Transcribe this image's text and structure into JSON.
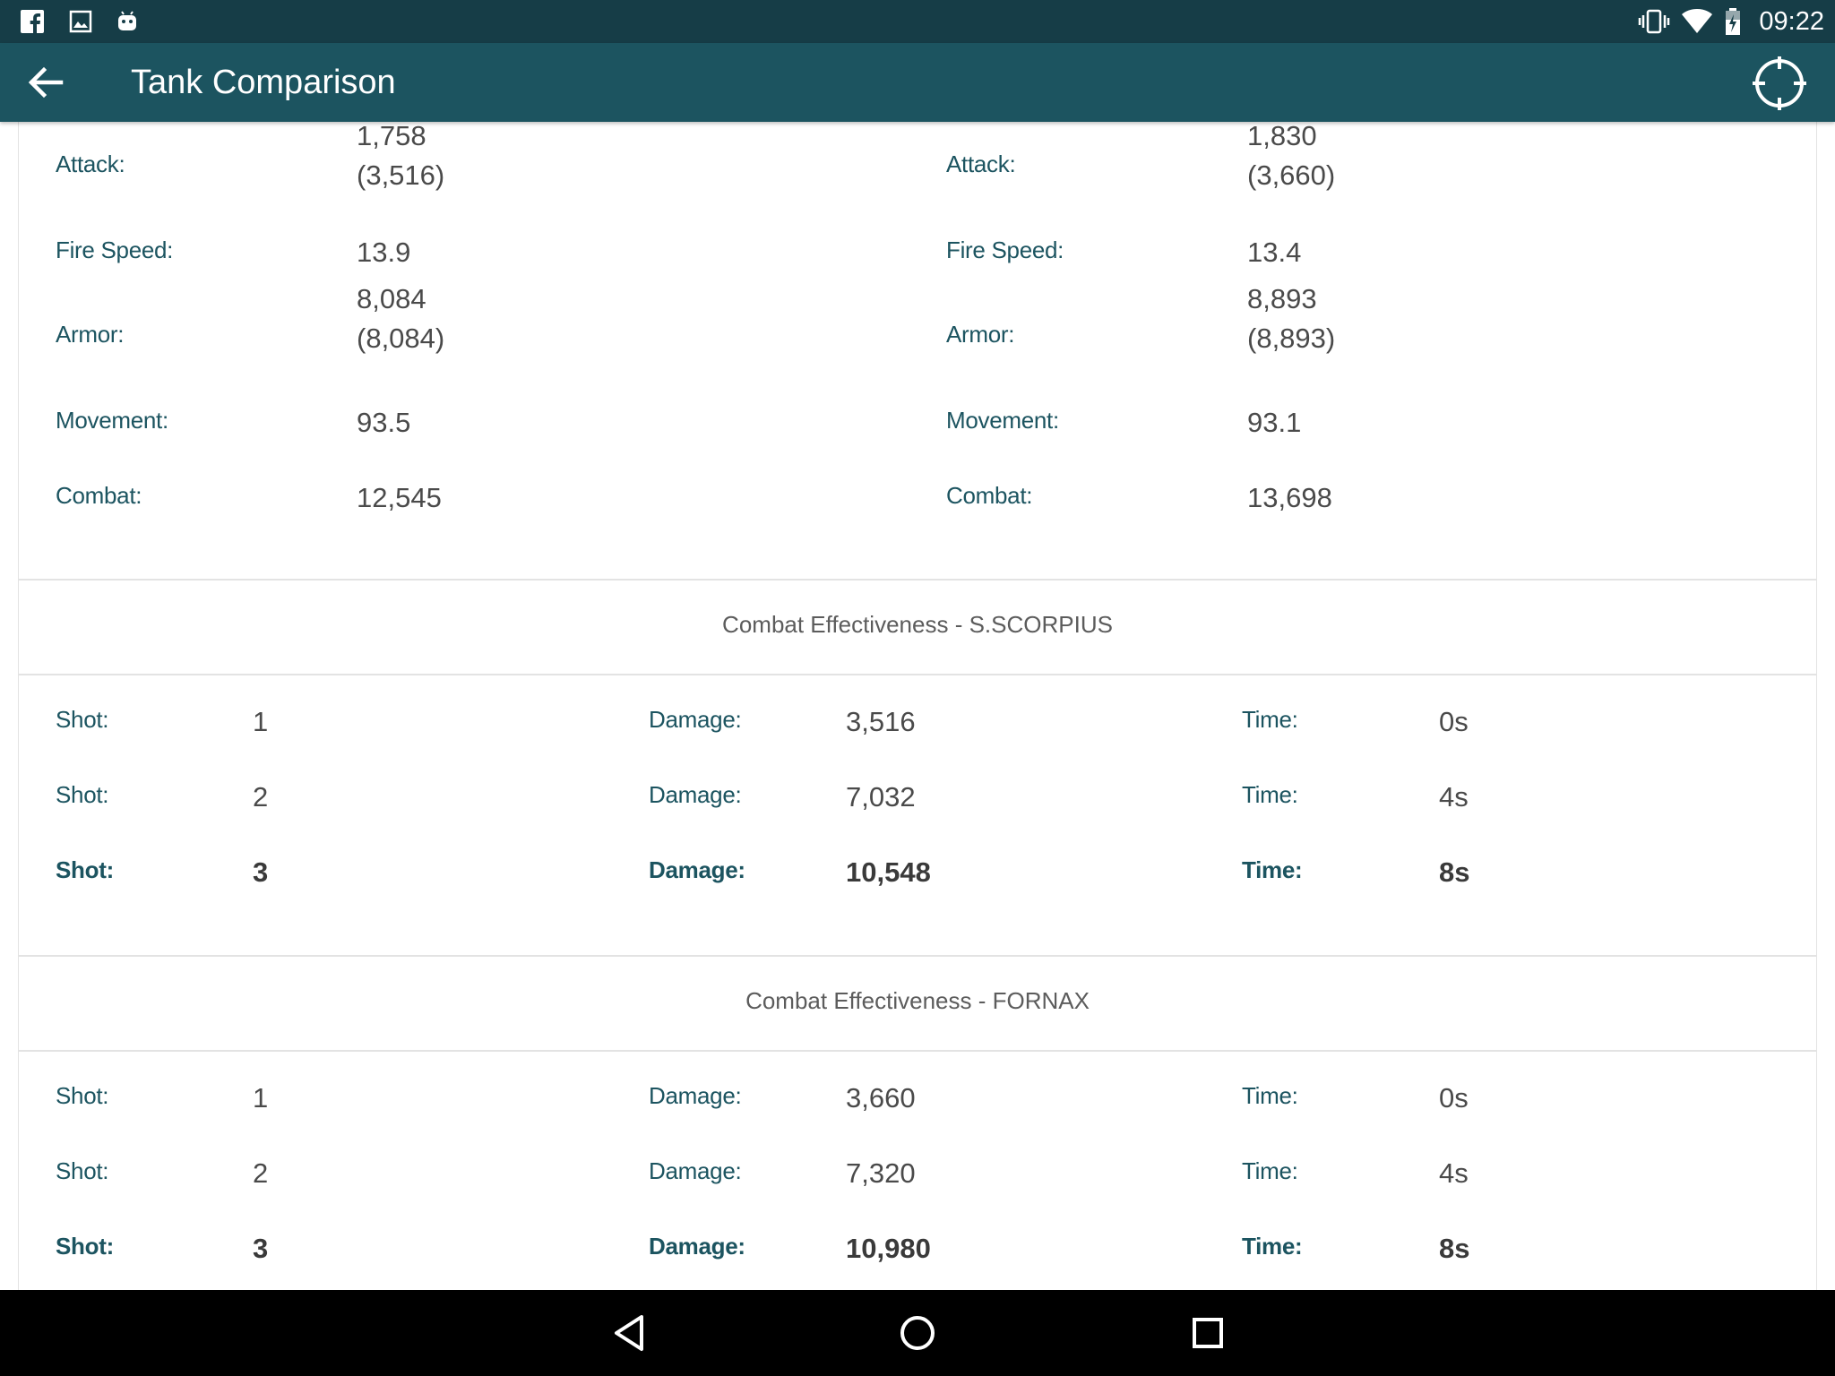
{
  "status_bar": {
    "time": "09:22",
    "left_icons": [
      "facebook-icon",
      "gallery-icon",
      "android-icon"
    ],
    "right_icons": [
      "vibrate-icon",
      "wifi-icon",
      "battery-charging-icon"
    ]
  },
  "app_bar": {
    "title": "Tank Comparison",
    "back_icon": "arrow-back-icon",
    "action_icon": "crosshair-icon"
  },
  "stats": {
    "left": {
      "attack_label": "Attack:",
      "attack_value": "1,758",
      "attack_sub": "(3,516)",
      "fire_speed_label": "Fire Speed:",
      "fire_speed_value": "13.9",
      "armor_label": "Armor:",
      "armor_value": "8,084",
      "armor_sub": "(8,084)",
      "movement_label": "Movement:",
      "movement_value": "93.5",
      "combat_label": "Combat:",
      "combat_value": "12,545"
    },
    "right": {
      "attack_label": "Attack:",
      "attack_value": "1,830",
      "attack_sub": "(3,660)",
      "fire_speed_label": "Fire Speed:",
      "fire_speed_value": "13.4",
      "armor_label": "Armor:",
      "armor_value": "8,893",
      "armor_sub": "(8,893)",
      "movement_label": "Movement:",
      "movement_value": "93.1",
      "combat_label": "Combat:",
      "combat_value": "13,698"
    }
  },
  "effectiveness": [
    {
      "title": "Combat Effectiveness - S.SCORPIUS",
      "rows": [
        {
          "shot_label": "Shot:",
          "shot": "1",
          "damage_label": "Damage:",
          "damage": "3,516",
          "time_label": "Time:",
          "time": "0s"
        },
        {
          "shot_label": "Shot:",
          "shot": "2",
          "damage_label": "Damage:",
          "damage": "7,032",
          "time_label": "Time:",
          "time": "4s"
        },
        {
          "shot_label": "Shot:",
          "shot": "3",
          "damage_label": "Damage:",
          "damage": "10,548",
          "time_label": "Time:",
          "time": "8s"
        }
      ]
    },
    {
      "title": "Combat Effectiveness - FORNAX",
      "rows": [
        {
          "shot_label": "Shot:",
          "shot": "1",
          "damage_label": "Damage:",
          "damage": "3,660",
          "time_label": "Time:",
          "time": "0s"
        },
        {
          "shot_label": "Shot:",
          "shot": "2",
          "damage_label": "Damage:",
          "damage": "7,320",
          "time_label": "Time:",
          "time": "4s"
        },
        {
          "shot_label": "Shot:",
          "shot": "3",
          "damage_label": "Damage:",
          "damage": "10,980",
          "time_label": "Time:",
          "time": "8s"
        }
      ]
    }
  ],
  "nav_bar": {
    "icons": [
      "nav-back-icon",
      "nav-home-icon",
      "nav-recents-icon"
    ]
  },
  "colors": {
    "status_bar": "#163d47",
    "app_bar": "#1c5460",
    "label_text": "#1c5460",
    "nav_bar": "#000000"
  }
}
